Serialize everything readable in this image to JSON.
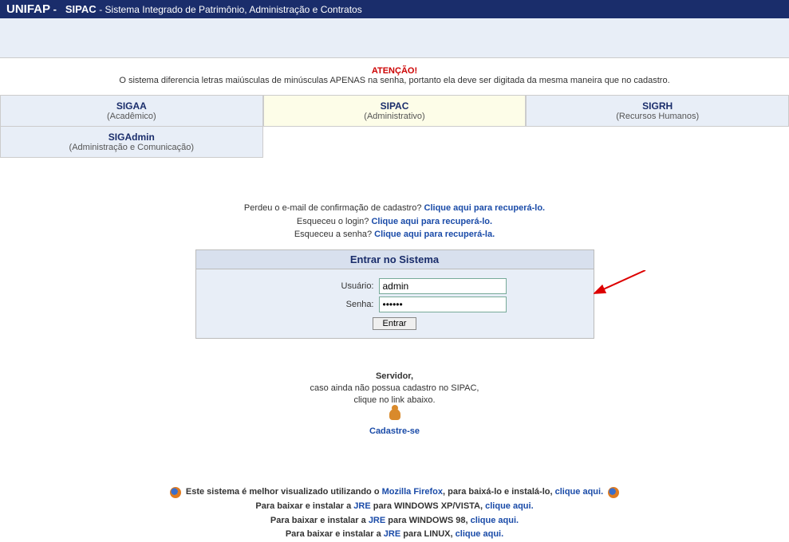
{
  "header": {
    "brand": "UNIFAP",
    "sep": "-",
    "system": "SIPAC",
    "desc": "- Sistema Integrado de Patrimônio, Administração e Contratos"
  },
  "attention": {
    "title": "ATENÇÃO!",
    "text": "O sistema diferencia letras maiúsculas de minúsculas APENAS na senha, portanto ela deve ser digitada da mesma maneira que no cadastro."
  },
  "tabs": {
    "sigaa": {
      "title": "SIGAA",
      "sub": "(Acadêmico)"
    },
    "sipac": {
      "title": "SIPAC",
      "sub": "(Administrativo)"
    },
    "sigrh": {
      "title": "SIGRH",
      "sub": "(Recursos Humanos)"
    },
    "sigadmin": {
      "title": "SIGAdmin",
      "sub": "(Administração e Comunicação)"
    }
  },
  "recover": {
    "line1_pre": "Perdeu o e-mail de confirmação de cadastro? ",
    "line1_link": "Clique aqui para recuperá-lo.",
    "line2_pre": "Esqueceu o login? ",
    "line2_link": "Clique aqui para recuperá-lo.",
    "line3_pre": "Esqueceu a senha? ",
    "line3_link": "Clique aqui para recuperá-la."
  },
  "login": {
    "title": "Entrar no Sistema",
    "user_label": "Usuário:",
    "user_value": "admin",
    "pass_label": "Senha:",
    "pass_value": "••••••",
    "submit": "Entrar"
  },
  "signup": {
    "heading": "Servidor,",
    "line1": "caso ainda não possua cadastro no SIPAC,",
    "line2": "clique no link abaixo.",
    "link": "Cadastre-se"
  },
  "footer": {
    "line1_pre": "Este sistema é melhor visualizado utilizando o ",
    "line1_ff": "Mozilla Firefox",
    "line1_mid": ", para baixá-lo e instalá-lo, ",
    "line1_link": "clique aqui.",
    "line2_pre": "Para baixar e instalar a ",
    "jre": "JRE",
    "line2_mid": " para WINDOWS XP/VISTA, ",
    "line2_link": "clique aqui.",
    "line3_pre": "Para baixar e instalar a ",
    "line3_mid": " para WINDOWS 98, ",
    "line3_link": "clique aqui.",
    "line4_pre": "Para baixar e instalar a ",
    "line4_mid": " para LINUX, ",
    "line4_link": "clique aqui."
  }
}
